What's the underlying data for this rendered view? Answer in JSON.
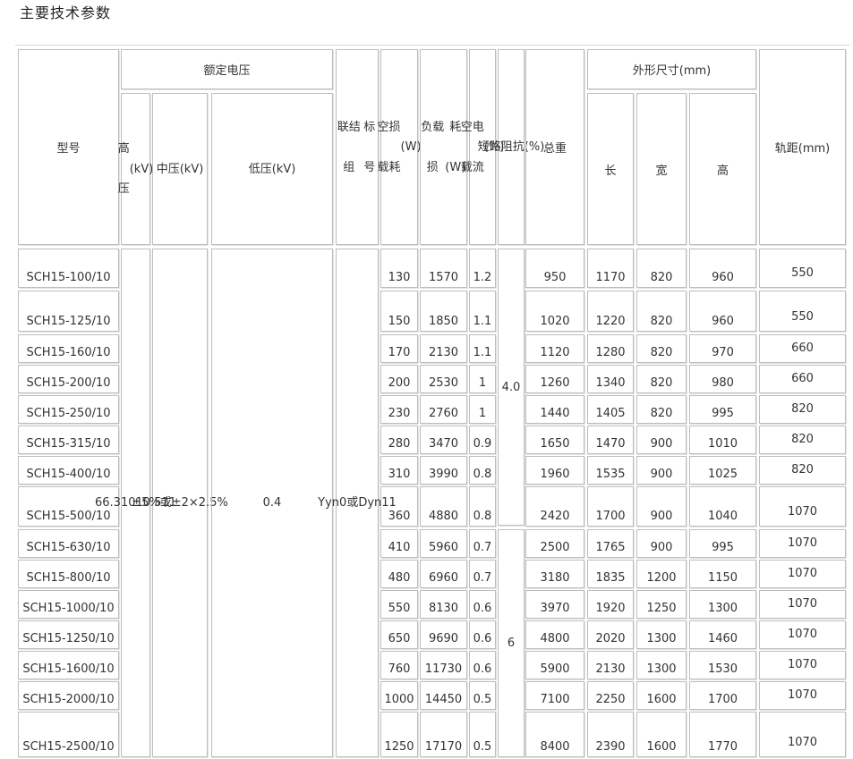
{
  "page": {
    "title": "主要技术参数"
  },
  "header": {
    "model": "型号",
    "rated_voltage": "额定电压",
    "hv": [
      "高压",
      "(kV)"
    ],
    "mv": [
      "中压",
      "(kV)"
    ],
    "lv": [
      "低压",
      "(kV)"
    ],
    "group": [
      "联结组",
      "标号"
    ],
    "noload_loss": [
      "空载",
      "损耗",
      "(W)"
    ],
    "load_loss": [
      "负载损",
      "耗(W)"
    ],
    "noload_current": [
      "空载",
      "电流",
      "(%)"
    ],
    "impedance": [
      "短",
      "路",
      "阻",
      "抗",
      "(%)"
    ],
    "weight": "总重",
    "dimensions": "外形尺寸(mm)",
    "length": "长",
    "width": "宽",
    "height": "高",
    "gauge": "轨距(mm)"
  },
  "merged": {
    "hv": [
      "6",
      "6.3",
      "10",
      "10.5",
      "11"
    ],
    "tap": [
      "±5%",
      "或",
      "±2×2.5%"
    ],
    "lv": "0.4",
    "group": [
      "Yyn0",
      "或",
      "Dyn11"
    ],
    "impedance_a": "4.0",
    "impedance_b": "6"
  },
  "rows": [
    {
      "model": "SCH15-100/10",
      "noload": "130",
      "load": "1570",
      "current": "1.2",
      "weight": "950",
      "l": "1170",
      "w": "820",
      "h": "960",
      "gauge": "550"
    },
    {
      "model": "SCH15-125/10",
      "noload": "150",
      "load": "1850",
      "current": "1.1",
      "weight": "1020",
      "l": "1220",
      "w": "820",
      "h": "960",
      "gauge": "550"
    },
    {
      "model": "SCH15-160/10",
      "noload": "170",
      "load": "2130",
      "current": "1.1",
      "weight": "1120",
      "l": "1280",
      "w": "820",
      "h": "970",
      "gauge": "660"
    },
    {
      "model": "SCH15-200/10",
      "noload": "200",
      "load": "2530",
      "current": "1",
      "weight": "1260",
      "l": "1340",
      "w": "820",
      "h": "980",
      "gauge": "660"
    },
    {
      "model": "SCH15-250/10",
      "noload": "230",
      "load": "2760",
      "current": "1",
      "weight": "1440",
      "l": "1405",
      "w": "820",
      "h": "995",
      "gauge": "820"
    },
    {
      "model": "SCH15-315/10",
      "noload": "280",
      "load": "3470",
      "current": "0.9",
      "weight": "1650",
      "l": "1470",
      "w": "900",
      "h": "1010",
      "gauge": "820"
    },
    {
      "model": "SCH15-400/10",
      "noload": "310",
      "load": "3990",
      "current": "0.8",
      "weight": "1960",
      "l": "1535",
      "w": "900",
      "h": "1025",
      "gauge": "820"
    },
    {
      "model": "SCH15-500/10",
      "noload": "360",
      "load": "4880",
      "current": "0.8",
      "weight": "2420",
      "l": "1700",
      "w": "900",
      "h": "1040",
      "gauge": "1070"
    },
    {
      "model": "SCH15-630/10",
      "noload": "410",
      "load": "5960",
      "current": "0.7",
      "weight": "2500",
      "l": "1765",
      "w": "900",
      "h": "995",
      "gauge": "1070"
    },
    {
      "model": "SCH15-800/10",
      "noload": "480",
      "load": "6960",
      "current": "0.7",
      "weight": "3180",
      "l": "1835",
      "w": "1200",
      "h": "1150",
      "gauge": "1070"
    },
    {
      "model": "SCH15-1000/10",
      "noload": "550",
      "load": "8130",
      "current": "0.6",
      "weight": "3970",
      "l": "1920",
      "w": "1250",
      "h": "1300",
      "gauge": "1070"
    },
    {
      "model": "SCH15-1250/10",
      "noload": "650",
      "load": "9690",
      "current": "0.6",
      "weight": "4800",
      "l": "2020",
      "w": "1300",
      "h": "1460",
      "gauge": "1070"
    },
    {
      "model": "SCH15-1600/10",
      "noload": "760",
      "load": "11730",
      "current": "0.6",
      "weight": "5900",
      "l": "2130",
      "w": "1300",
      "h": "1530",
      "gauge": "1070"
    },
    {
      "model": "SCH15-2000/10",
      "noload": "1000",
      "load": "14450",
      "current": "0.5",
      "weight": "7100",
      "l": "2250",
      "w": "1600",
      "h": "1700",
      "gauge": "1070"
    },
    {
      "model": "SCH15-2500/10",
      "noload": "1250",
      "load": "17170",
      "current": "0.5",
      "weight": "8400",
      "l": "2390",
      "w": "1600",
      "h": "1770",
      "gauge": "1070"
    }
  ]
}
